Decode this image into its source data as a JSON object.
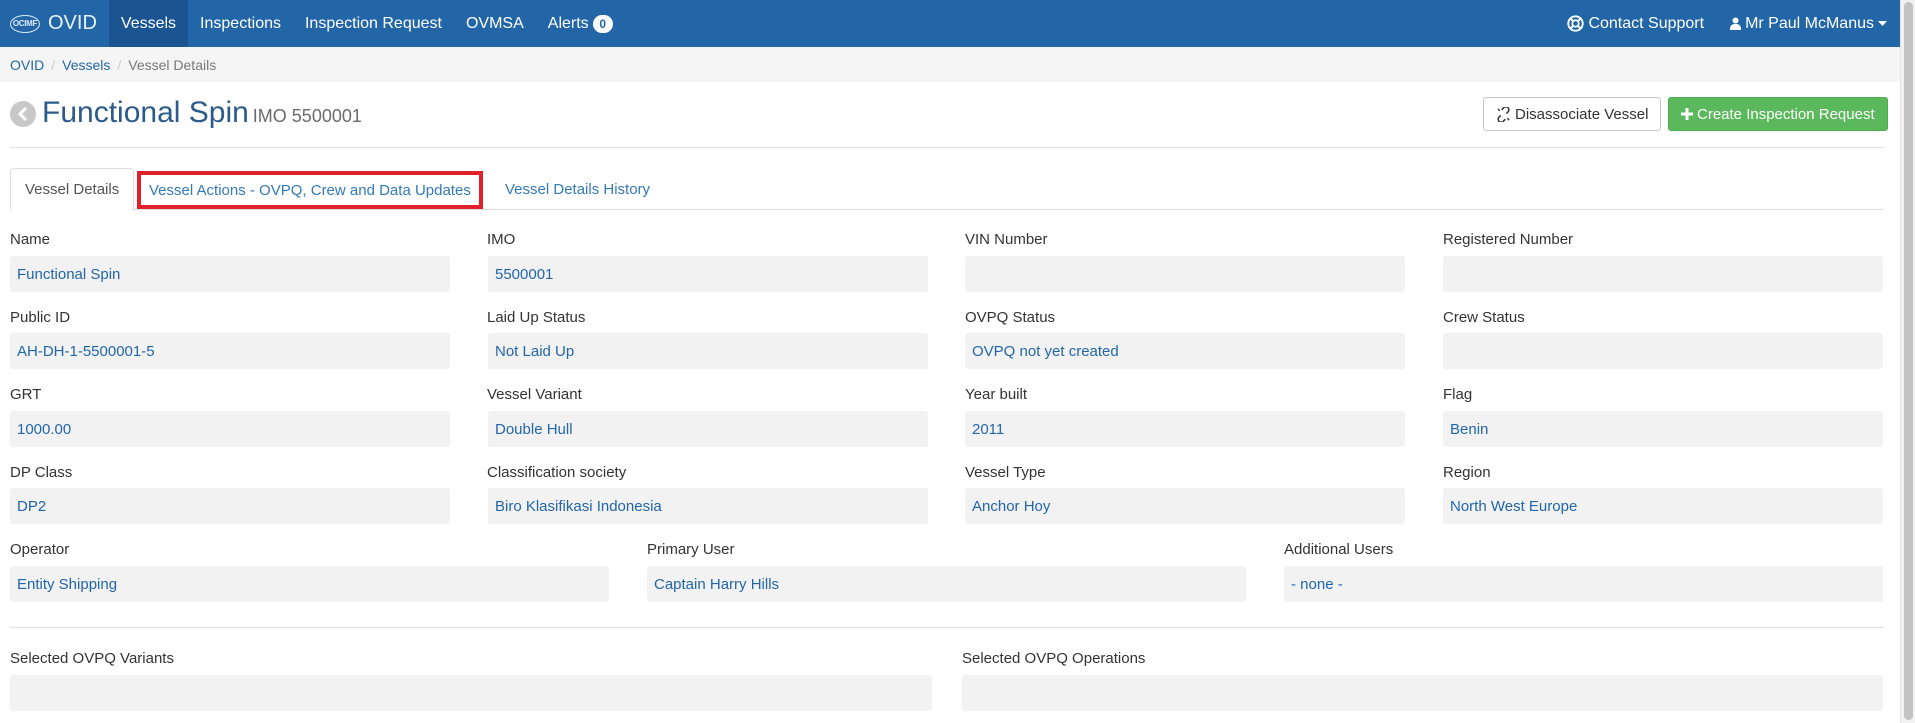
{
  "navbar": {
    "brand_logo": "OCIMF",
    "brand_name": "OVID",
    "items": [
      {
        "label": "Vessels",
        "active": true
      },
      {
        "label": "Inspections"
      },
      {
        "label": "Inspection Request"
      },
      {
        "label": "OVMSA"
      },
      {
        "label": "Alerts"
      }
    ],
    "alerts_count": "0",
    "contact_support": "Contact Support",
    "user_name": "Mr Paul McManus",
    "icons": {
      "support": "life-ring-icon",
      "user": "user-icon",
      "caret": "caret-down-icon"
    }
  },
  "breadcrumb": {
    "items": [
      "OVID",
      "Vessels",
      "Vessel Details"
    ],
    "separator": "/"
  },
  "header": {
    "title": "Functional Spin",
    "subtitle": "IMO 5500001",
    "disassociate_label": "Disassociate Vessel",
    "create_label": "Create Inspection Request",
    "icons": {
      "back": "chevron-left-circle-icon",
      "unlink": "unlink-icon",
      "plus": "plus-icon"
    }
  },
  "tabs": [
    {
      "label": "Vessel Details",
      "active": true
    },
    {
      "label": "Vessel Actions - OVPQ, Crew and Data Updates",
      "highlighted": true
    },
    {
      "label": "Vessel Details History"
    }
  ],
  "fields": {
    "name": {
      "label": "Name",
      "value": "Functional Spin"
    },
    "imo": {
      "label": "IMO",
      "value": "5500001"
    },
    "vin": {
      "label": "VIN Number",
      "value": ""
    },
    "registered": {
      "label": "Registered Number",
      "value": ""
    },
    "public_id": {
      "label": "Public ID",
      "value": "AH-DH-1-5500001-5"
    },
    "laid_up": {
      "label": "Laid Up Status",
      "value": "Not Laid Up"
    },
    "ovpq_status": {
      "label": "OVPQ Status",
      "value": "OVPQ not yet created"
    },
    "crew_status": {
      "label": "Crew Status",
      "value": ""
    },
    "grt": {
      "label": "GRT",
      "value": "1000.00"
    },
    "variant": {
      "label": "Vessel Variant",
      "value": "Double Hull"
    },
    "year_built": {
      "label": "Year built",
      "value": "2011"
    },
    "flag": {
      "label": "Flag",
      "value": "Benin"
    },
    "dp_class": {
      "label": "DP Class",
      "value": "DP2"
    },
    "class_society": {
      "label": "Classification society",
      "value": "Biro Klasifikasi Indonesia"
    },
    "vessel_type": {
      "label": "Vessel Type",
      "value": "Anchor Hoy"
    },
    "region": {
      "label": "Region",
      "value": "North West Europe"
    },
    "operator": {
      "label": "Operator",
      "value": "Entity Shipping"
    },
    "primary_user": {
      "label": "Primary User",
      "value": "Captain Harry Hills"
    },
    "additional_users": {
      "label": "Additional Users",
      "value": "- none -"
    },
    "ovpq_variants": {
      "label": "Selected OVPQ Variants",
      "value": ""
    },
    "ovpq_operations": {
      "label": "Selected OVPQ Operations",
      "value": ""
    }
  },
  "colors": {
    "navbar": "#2266a8",
    "navbar_active": "#1a5491",
    "link": "#2266a8",
    "success": "#5cb85c",
    "highlight_border": "#e0202a",
    "field_bg": "#f2f2f3"
  }
}
